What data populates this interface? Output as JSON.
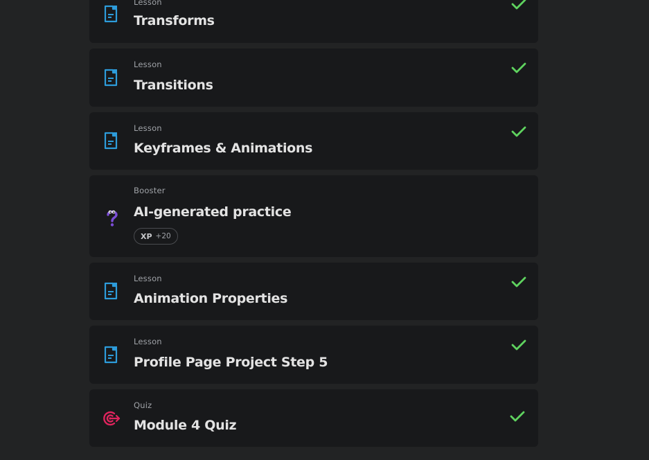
{
  "items": [
    {
      "kind": "Lesson",
      "title": "Transforms",
      "icon": "lesson-document-icon",
      "completed": true
    },
    {
      "kind": "Lesson",
      "title": "Transitions",
      "icon": "lesson-document-icon",
      "completed": true
    },
    {
      "kind": "Lesson",
      "title": "Keyframes & Animations",
      "icon": "lesson-document-icon",
      "completed": true
    },
    {
      "kind": "Booster",
      "title": "AI-generated practice",
      "icon": "question-mark-icon",
      "completed": false,
      "xp_label": "XP",
      "xp_value": "+20"
    },
    {
      "kind": "Lesson",
      "title": "Animation Properties",
      "icon": "lesson-document-icon",
      "completed": true
    },
    {
      "kind": "Lesson",
      "title": "Profile Page Project Step 5",
      "icon": "lesson-document-icon",
      "completed": true
    },
    {
      "kind": "Quiz",
      "title": "Module 4 Quiz",
      "icon": "quiz-target-icon",
      "completed": true
    }
  ],
  "colors": {
    "background": "#222324",
    "card": "#18191b",
    "lesson_icon": "#2d9cdb",
    "booster_icon": "#7b4dd6",
    "quiz_icon": "#e0245e",
    "check": "#5fd35f"
  }
}
